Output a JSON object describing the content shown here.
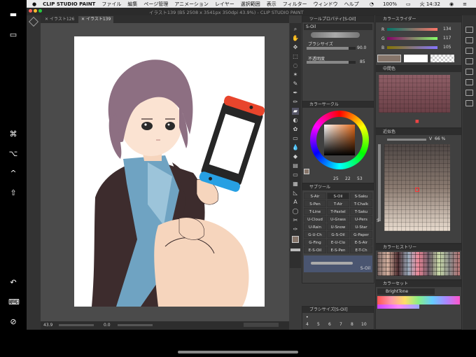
{
  "menubar": {
    "app_name": "CLIP STUDIO PAINT",
    "items": [
      "ファイル",
      "編集",
      "ページ管理",
      "アニメーション",
      "レイヤー",
      "選択範囲",
      "表示",
      "フィルター",
      "ウィンドウ",
      "ヘルプ"
    ],
    "battery": "100%",
    "clock": "火 14:32"
  },
  "window": {
    "title": "イラスト139 (B5 2508 x 3541px 350dpi 43.9%) - CLIP STUDIO PAINT",
    "tabs": [
      "イラスト126",
      "イラスト139"
    ]
  },
  "status": {
    "zoom": "43.9",
    "angle": "0.0"
  },
  "tool_property": {
    "header": "ツールプロパティ[S-Oil]",
    "tool": "S-Oil",
    "brush_size_label": "ブラシサイズ",
    "brush_size_value": "90.0",
    "opacity_label": "不透明度",
    "opacity_value": "85"
  },
  "color_circle": {
    "header": "カラーサークル",
    "h": "25",
    "s": "22",
    "v": "53"
  },
  "sub_tool": {
    "header": "サブツール",
    "items": [
      "S-Air",
      "S-Oil",
      "S-Saku",
      "S-Pen",
      "T-Air",
      "T-Chalk",
      "T-Line",
      "T-Pastel",
      "T-Saku",
      "U-Cloud",
      "U-Grass",
      "U-Pers",
      "U-Rain",
      "U-Snow",
      "U-Star",
      "G-U-Ch",
      "G-S-Oil",
      "G-Paper",
      "G-Fing",
      "E-U-Clo",
      "E-S-Air",
      "E-S-Oil",
      "E-S-Pen",
      "E-T-Ch"
    ],
    "selected": "S-Oil",
    "selected_stroke": "S-Oil"
  },
  "brush_size_panel": {
    "header": "ブラシサイズ[S-Oil]",
    "sizes": [
      "4",
      "5",
      "6",
      "7",
      "8",
      "10"
    ]
  },
  "color_slider": {
    "header": "カラースライダー",
    "r": "134",
    "g": "117",
    "b": "105"
  },
  "intermediate": {
    "header": "中間色"
  },
  "approx": {
    "header": "近似色",
    "v_label": "V",
    "v_value": "66 %",
    "s_label": "S"
  },
  "history": {
    "header": "カラーヒストリー"
  },
  "color_set": {
    "header": "カラーセット",
    "name": "BrightTone"
  },
  "colors": {
    "bg": "#3b3b3b",
    "panel": "#404040",
    "accent": "#8b6f8f",
    "current_color": "#86756a"
  }
}
